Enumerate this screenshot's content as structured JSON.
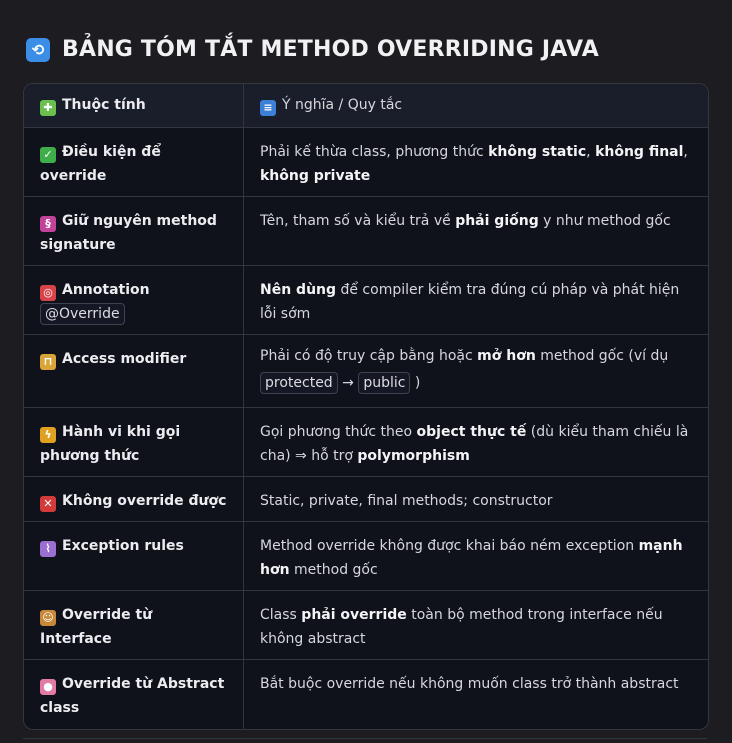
{
  "title": "BẢNG TÓM TẮT METHOD OVERRIDING JAVA",
  "header": {
    "col1": "Thuộc tính",
    "col2": "Ý nghĩa / Quy tắc"
  },
  "rows": [
    {
      "attr": "Điều kiện để override",
      "d1": "Phải kế thừa class, phương thức ",
      "b1": "không static",
      "d2": ", ",
      "b2": "không final",
      "d3": ", ",
      "b3": "không private"
    },
    {
      "attr": "Giữ nguyên method signature",
      "d1": "Tên, tham số và kiểu trả về ",
      "b1": "phải giống",
      "d2": " y như method gốc"
    },
    {
      "attr": "Annotation",
      "code": "@Override",
      "b1": "Nên dùng",
      "d1": " để compiler kiểm tra đúng cú pháp và phát hiện lỗi sớm"
    },
    {
      "attr": "Access modifier",
      "d1": "Phải có độ truy cập bằng hoặc ",
      "b1": "mở hơn",
      "d2": " method gốc (ví dụ",
      "code1": "protected",
      "arrow": "→",
      "code2": "public",
      "d3": ")"
    },
    {
      "attr": "Hành vi khi gọi phương thức",
      "d1": "Gọi phương thức theo ",
      "b1": "object thực tế",
      "d2": " (dù kiểu tham chiếu là cha) ⇒ hỗ trợ ",
      "b2": "polymorphism"
    },
    {
      "attr": "Không override được",
      "d1": "Static, private, final methods; constructor"
    },
    {
      "attr": "Exception rules",
      "d1": "Method override không được khai báo ném exception ",
      "b1": "mạnh hơn",
      "d2": " method gốc"
    },
    {
      "attr": "Override từ Interface",
      "d1": "Class ",
      "b1": "phải override",
      "d2": " toàn bộ method trong interface nếu không abstract"
    },
    {
      "attr": "Override từ Abstract class",
      "d1": "Bắt buộc override nếu không muốn class trở thành abstract"
    }
  ],
  "icons": {
    "title": "refresh-icon",
    "col1": "puzzle-icon",
    "col2": "books-icon",
    "r0": "check-icon",
    "r1": "dna-icon",
    "r2": "target-icon",
    "r3": "unlock-icon",
    "r4": "lightning-icon",
    "r5": "cross-icon",
    "r6": "test-tube-icon",
    "r7": "robot-icon",
    "r8": "brain-icon"
  },
  "colors": {
    "background": "#1c1c21",
    "table": "#0f111b",
    "border": "#34363f"
  }
}
